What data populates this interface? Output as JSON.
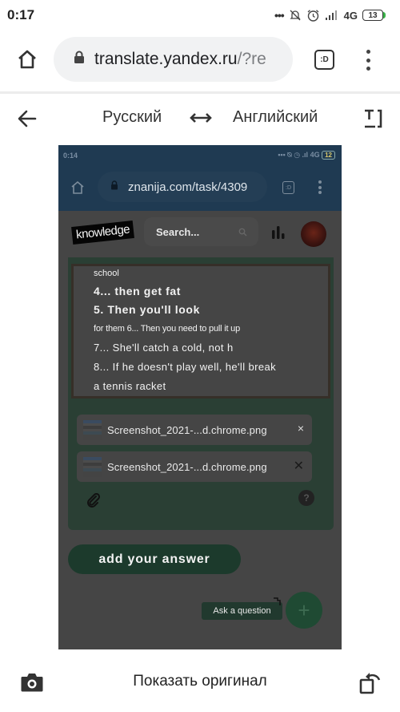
{
  "status_bar": {
    "time": "0:17",
    "network": "4G",
    "battery": "13",
    "icons": [
      "more-dots-icon",
      "notifications-off-icon",
      "alarm-icon",
      "signal-icon",
      "battery-icon"
    ]
  },
  "browser": {
    "url_host": "translate.yandex.ru",
    "url_rest": "/?re",
    "tabs_label": ":D",
    "icons": [
      "home-icon",
      "lock-icon",
      "tabs-icon",
      "menu-icon"
    ]
  },
  "translate_header": {
    "source_lang": "Русский",
    "target_lang": "Английский",
    "icons": [
      "back-arrow-icon",
      "swap-icon",
      "text-mode-icon"
    ]
  },
  "embedded_screenshot": {
    "status_bar": {
      "time": "0:14",
      "network": "4G",
      "battery": "12"
    },
    "browser": {
      "url": "znanija.com/task/4309",
      "tabs_label": ":D"
    },
    "site": {
      "logo": "knowledge",
      "search_placeholder": "Search...",
      "text_lines": [
        "school",
        "4... then get fat",
        "5. Then you'll look",
        "for them 6... Then you need to pull it up",
        "7... She'll catch a cold, not h",
        "8... If he doesn't play well, he'll break",
        "a tennis racket"
      ],
      "attachments": [
        {
          "name": "Screenshot_2021-...d.chrome.png",
          "close": "×"
        },
        {
          "name": "Screenshot_2021-...d.chrome.png",
          "close": "✕"
        }
      ],
      "help_label": "?",
      "add_answer_label": "add your answer",
      "ask_question_tooltip": "Ask a question",
      "fab_label": "+"
    }
  },
  "bottom_bar": {
    "show_original_label": "Показать оригинал",
    "icons": [
      "camera-icon",
      "rotate-icon"
    ]
  }
}
